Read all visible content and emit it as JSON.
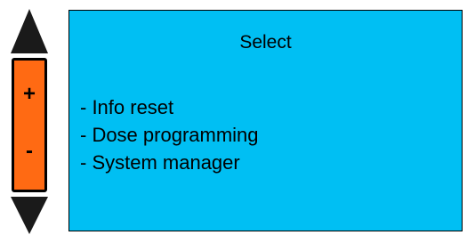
{
  "colors": {
    "screen_background": "#00BFF3",
    "control_background": "#FF6A13",
    "arrow": "#1A1A1A"
  },
  "icons": {
    "up": "triangle-up-icon",
    "down": "triangle-down-icon"
  },
  "controls": {
    "plus_label": "+",
    "minus_label": "-"
  },
  "screen": {
    "title": "Select",
    "menu_items": [
      {
        "label": "- Info reset"
      },
      {
        "label": "- Dose programming"
      },
      {
        "label": "- System manager"
      }
    ]
  }
}
